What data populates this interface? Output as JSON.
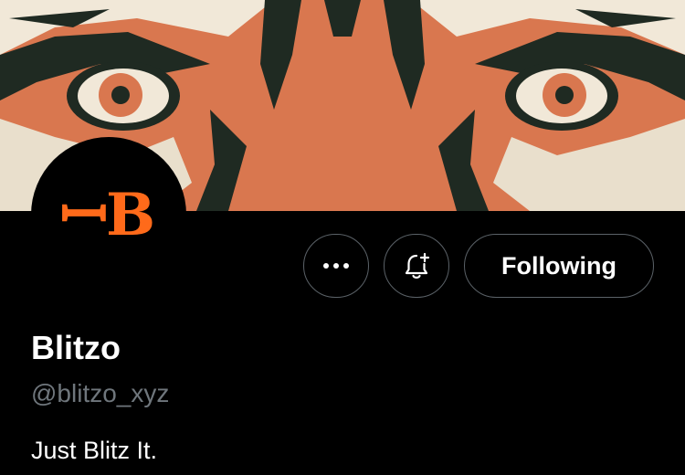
{
  "profile": {
    "display_name": "Blitzo",
    "handle": "@blitzo_xyz",
    "bio": "Just Blitz It.",
    "avatar_logo": "ꟷB",
    "banner_image": "tiger-eyes-illustration"
  },
  "actions": {
    "more_icon": "ellipsis-icon",
    "notify_icon": "bell-plus-icon",
    "follow_label": "Following"
  },
  "colors": {
    "background": "#000000",
    "banner_orange": "#d9774f",
    "logo_orange": "#ff6a1a",
    "button_border": "#5b6268",
    "handle_gray": "#6f767c"
  }
}
